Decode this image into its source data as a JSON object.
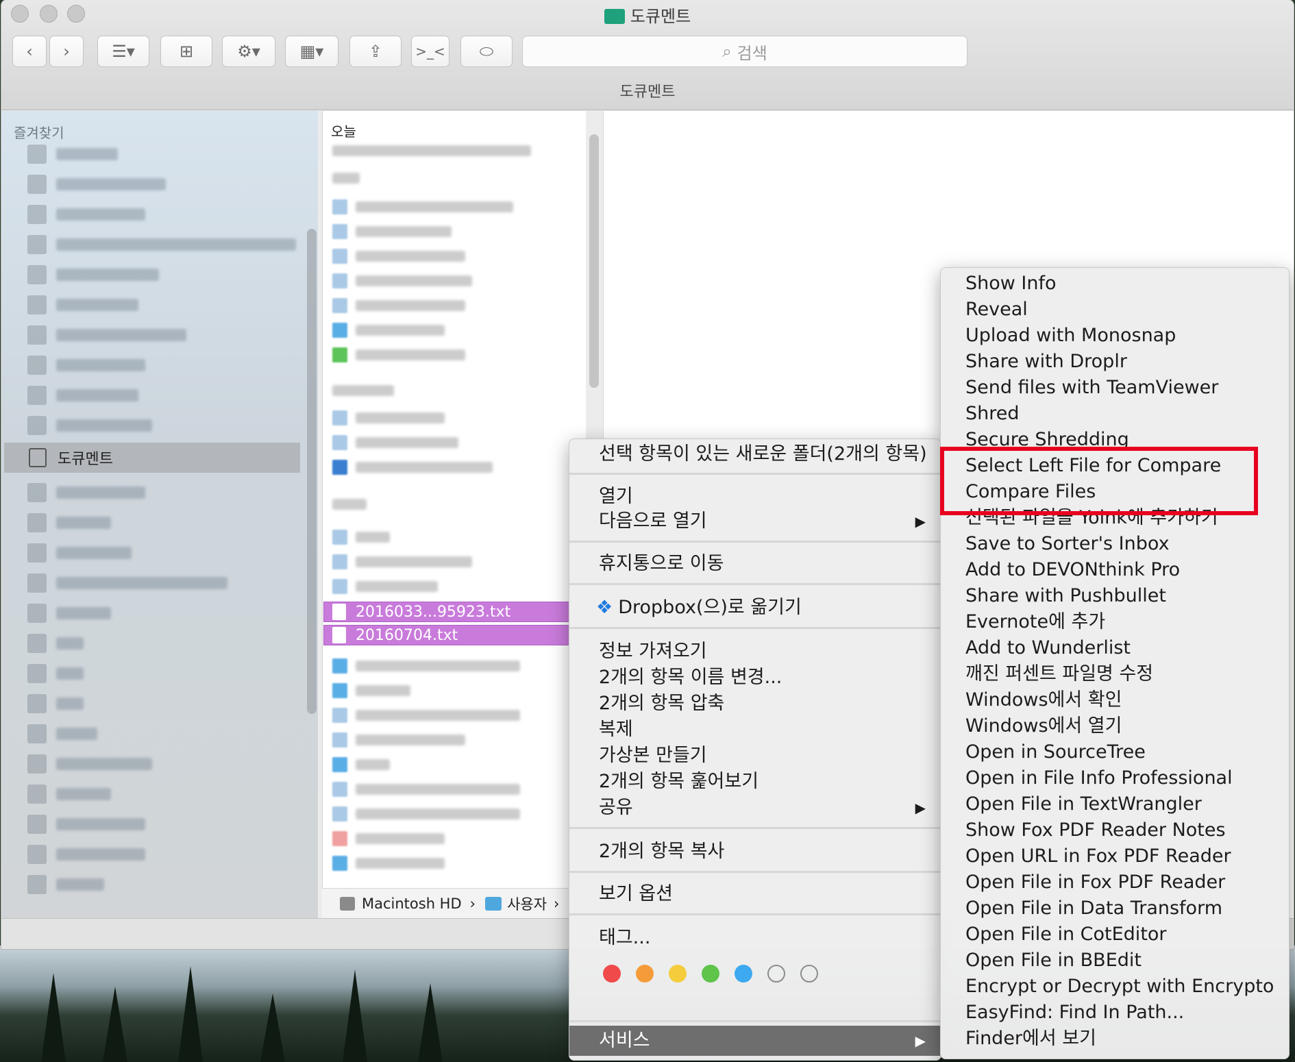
{
  "window": {
    "title": "도큐멘트",
    "path_title": "도큐멘트",
    "search_placeholder": "검색"
  },
  "toolbar": {
    "back": "‹",
    "forward": "›",
    "terminal_label": ">_<"
  },
  "sidebar": {
    "header": "즐겨찾기",
    "selected_item": "도큐멘트"
  },
  "column": {
    "header": "오늘",
    "selected_files": [
      "2016033...95923.txt",
      "20160704.txt"
    ]
  },
  "statusbar": {
    "disk": "Macintosh HD",
    "sep1": "›",
    "users": "사용자",
    "sep2": "›"
  },
  "context_menu": {
    "new_folder": "선택 항목이 있는 새로운 폴더(2개의 항목)",
    "open": "열기",
    "open_with": "다음으로 열기",
    "move_to_trash": "휴지통으로 이동",
    "dropbox": "Dropbox(으)로 옮기기",
    "get_info": "정보 가져오기",
    "rename": "2개의 항목 이름 변경...",
    "compress": "2개의 항목 압축",
    "duplicate": "복제",
    "make_alias": "가상본 만들기",
    "quick_look": "2개의 항목 훑어보기",
    "share": "공유",
    "copy": "2개의 항목 복사",
    "view_options": "보기 옵션",
    "tags": "태그...",
    "services": "서비스",
    "submenu_arrow": "▶",
    "tag_colors": [
      "#f04a4a",
      "#f59b3a",
      "#f5cd3c",
      "#5ec44a",
      "#3da9f0"
    ]
  },
  "services_menu": {
    "items": [
      "Show Info",
      "Reveal",
      "Upload with Monosnap",
      "Share with Droplr",
      "Send files with TeamViewer",
      "Shred",
      "Secure Shredding",
      "Select Left File for Compare",
      "Compare Files",
      "선택된 파일을 Yoink에 추가하기",
      "Save to Sorter's Inbox",
      "Add to DEVONthink Pro",
      "Share with Pushbullet",
      "Evernote에 추가",
      "Add to Wunderlist",
      "깨진 퍼센트 파일명 수정",
      "Windows에서 확인",
      "Windows에서 열기",
      "Open in SourceTree",
      "Open in File Info Professional",
      "Open File in TextWrangler",
      "Show Fox PDF Reader Notes",
      "Open URL in Fox PDF Reader",
      "Open File in Fox PDF Reader",
      "Open File in Data Transform",
      "Open File in CotEditor",
      "Open File in BBEdit",
      "Encrypt or Decrypt with Encrypto",
      "EasyFind: Find In Path...",
      "Finder에서 보기"
    ]
  },
  "colors": {
    "selection": "#c97bdb",
    "highlight_box": "#e8001f",
    "folder": "#1ea17c"
  }
}
